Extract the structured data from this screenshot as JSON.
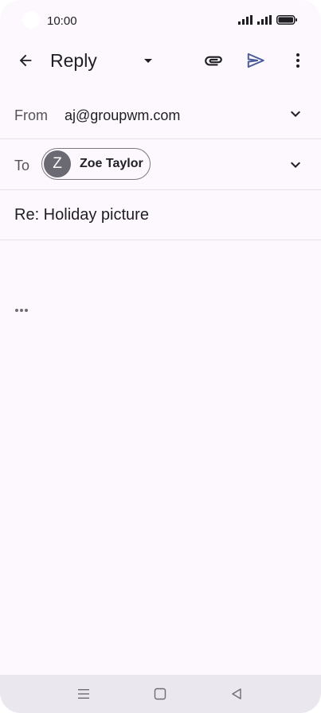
{
  "status_bar": {
    "time": "10:00",
    "icons": [
      "signal-icon",
      "signal-icon",
      "battery-icon"
    ]
  },
  "app_bar": {
    "title": "Reply",
    "icons": [
      "back-arrow-icon",
      "dropdown-icon",
      "attach-icon",
      "send-icon",
      "more-vert-icon"
    ]
  },
  "from": {
    "label": "From",
    "value": "aj@groupwm.com"
  },
  "to": {
    "label": "To",
    "recipients": [
      {
        "initial": "Z",
        "name": "Zoe Taylor"
      }
    ]
  },
  "subject": {
    "value": "Re: Holiday picture"
  },
  "colors": {
    "background": "#fcf8fd",
    "send_accent": "#4a5a9a",
    "avatar": "#6b6a73",
    "nav_bar": "#ebe7ee"
  }
}
